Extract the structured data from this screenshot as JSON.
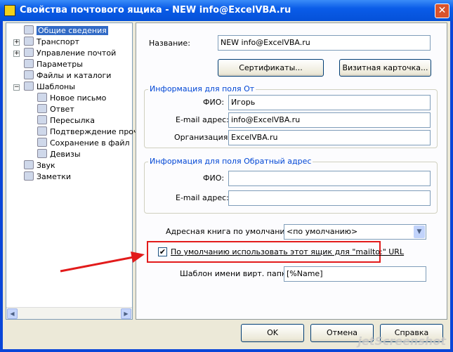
{
  "window": {
    "title": "Свойства почтового ящика - NEW info@ExcelVBA.ru",
    "close": "✕"
  },
  "tree": [
    {
      "label": "Общие сведения",
      "selected": true
    },
    {
      "label": "Транспорт",
      "expander": "+"
    },
    {
      "label": "Управление почтой",
      "expander": "+"
    },
    {
      "label": "Параметры"
    },
    {
      "label": "Файлы и каталоги"
    },
    {
      "label": "Шаблоны",
      "expander": "−"
    },
    {
      "label": "Новое письмо",
      "child": true
    },
    {
      "label": "Ответ",
      "child": true
    },
    {
      "label": "Пересылка",
      "child": true
    },
    {
      "label": "Подтверждение прочт",
      "child": true
    },
    {
      "label": "Сохранение в файл",
      "child": true
    },
    {
      "label": "Девизы",
      "child": true
    },
    {
      "label": "Звук"
    },
    {
      "label": "Заметки"
    }
  ],
  "general": {
    "name_label": "Название:",
    "name_value": "NEW info@ExcelVBA.ru",
    "cert_button": "Сертификаты...",
    "vcard_button": "Визитная карточка...",
    "from_group": "Информация для поля От",
    "fio_label": "ФИО:",
    "fio_value": "Игорь",
    "email_label": "E-mail адрес:",
    "email_value": "info@ExcelVBA.ru",
    "org_label": "Организация:",
    "org_value": "ExcelVBA.ru",
    "reply_group": "Информация для поля Обратный адрес",
    "reply_fio_label": "ФИО:",
    "reply_fio_value": "",
    "reply_email_label": "E-mail адрес:",
    "reply_email_value": "",
    "addrbook_label": "Адресная книга по умолчанию:",
    "addrbook_value": "<по умолчанию>",
    "mailto_label": "По умолчанию использовать этот ящик для \"mailto:\" URL",
    "mailto_checked": true,
    "folder_label": "Шаблон имени вирт. папки:",
    "folder_value": "[%Name]"
  },
  "buttons": {
    "ok": "OK",
    "cancel": "Отмена",
    "help": "Справка"
  },
  "watermark": "jetScreenshot",
  "annotation_color": "#e21b1b"
}
